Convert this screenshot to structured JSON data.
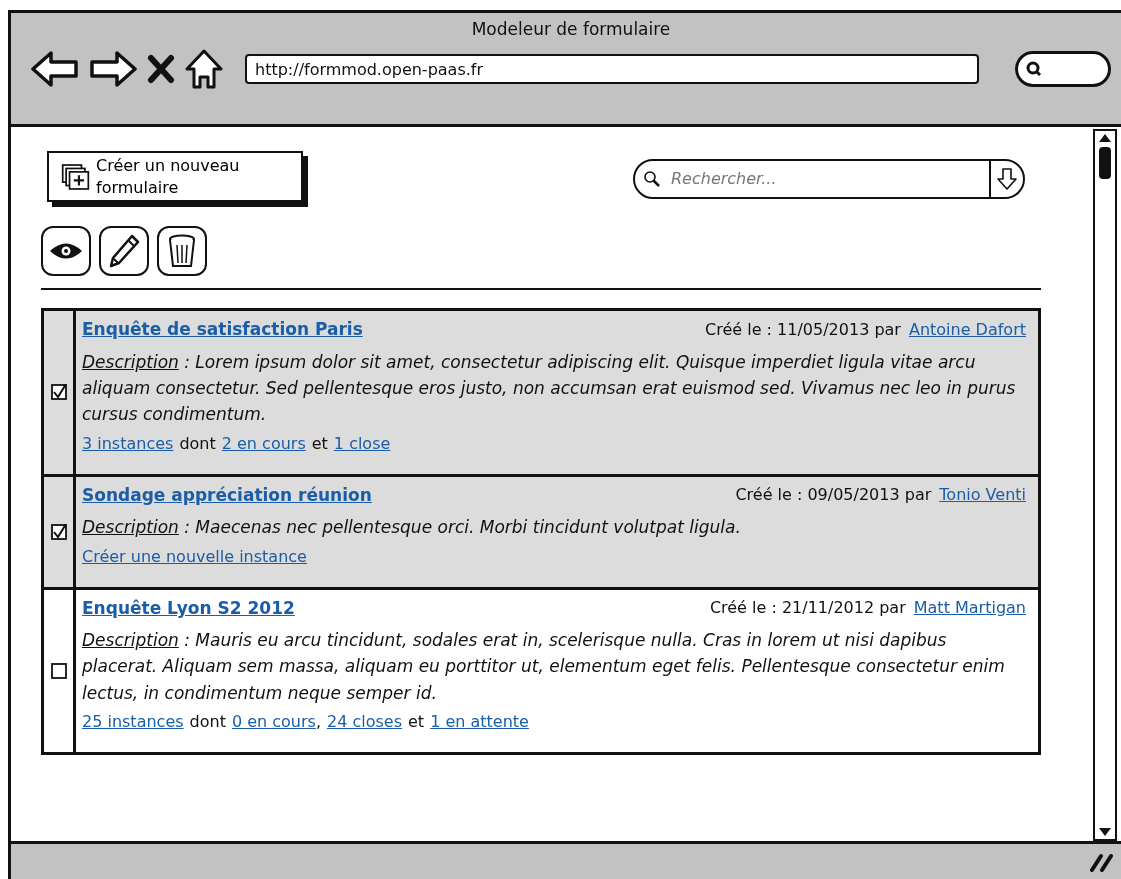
{
  "window": {
    "title": "Modeleur de formulaire",
    "url": "http://formmod.open-paas.fr"
  },
  "toolbar": {
    "create_button": "Créer un nouveau formulaire",
    "search": {
      "placeholder": "Rechercher..."
    }
  },
  "forms": [
    {
      "title": "Enquête de satisfaction Paris",
      "checked": true,
      "created": "Créé le : 11/05/2013 par",
      "author": "Antoine Dafort",
      "desc_label": "Description",
      "desc_text": " : Lorem ipsum dolor sit amet, consectetur adipiscing elit. Quisque imperdiet ligula vitae arcu aliquam consectetur. Sed pellentesque eros justo, non accumsan erat euismod sed. Vivamus nec leo in purus cursus condimentum.",
      "footer": [
        {
          "kind": "link",
          "text": "3 instances"
        },
        {
          "kind": "text",
          "text": "dont"
        },
        {
          "kind": "link",
          "text": "2 en cours"
        },
        {
          "kind": "text",
          "text": "et"
        },
        {
          "kind": "link",
          "text": "1 close"
        }
      ]
    },
    {
      "title": "Sondage appréciation réunion",
      "checked": true,
      "created": "Créé le : 09/05/2013 par",
      "author": "Tonio Venti",
      "desc_label": "Description",
      "desc_text": " : Maecenas nec pellentesque orci. Morbi tincidunt volutpat ligula.",
      "footer": [
        {
          "kind": "link",
          "text": "Créer une nouvelle instance"
        }
      ]
    },
    {
      "title": "Enquête Lyon S2 2012",
      "checked": false,
      "created": "Créé le : 21/11/2012 par",
      "author": "Matt Martigan",
      "desc_label": "Description",
      "desc_text": " : Mauris eu arcu tincidunt, sodales erat in, scelerisque nulla. Cras in lorem ut nisi dapibus placerat. Aliquam sem massa, aliquam eu porttitor ut, elementum eget felis. Pellentesque consectetur enim lectus, in condimentum neque semper id.",
      "footer": [
        {
          "kind": "link",
          "text": "25 instances"
        },
        {
          "kind": "text",
          "text": "dont"
        },
        {
          "kind": "link",
          "text": "0 en cours"
        },
        {
          "kind": "punct",
          "text": ","
        },
        {
          "kind": "link",
          "text": "24 closes"
        },
        {
          "kind": "text",
          "text": "et"
        },
        {
          "kind": "link",
          "text": "1 en attente"
        }
      ]
    }
  ]
}
